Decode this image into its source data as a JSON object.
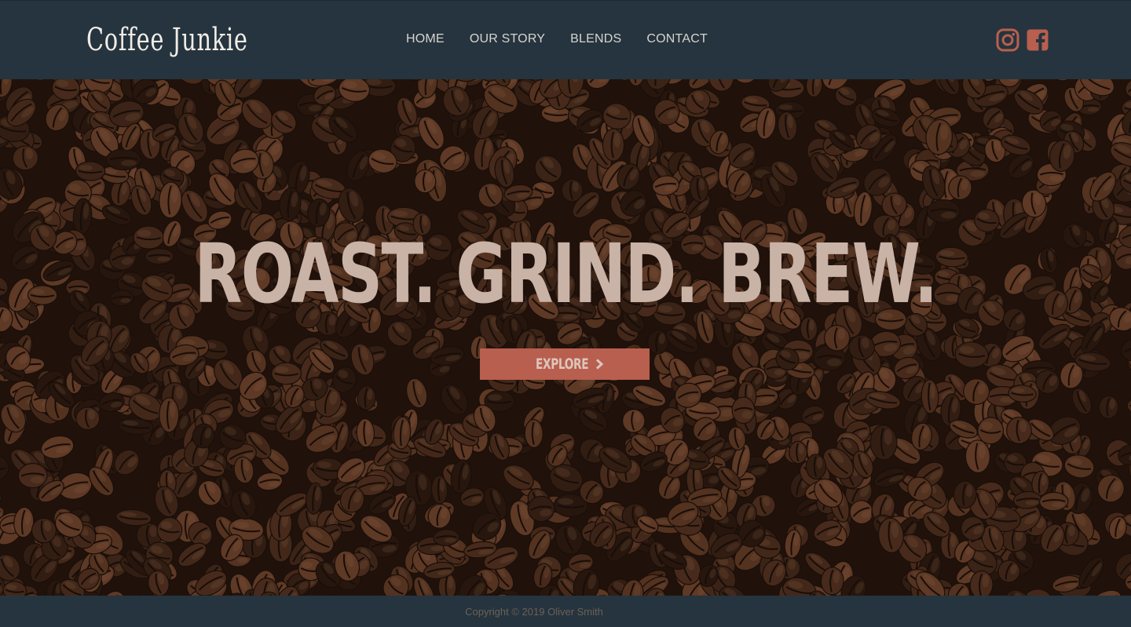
{
  "brand": {
    "name": "Coffee Junkie"
  },
  "nav": {
    "items": [
      {
        "label": "HOME"
      },
      {
        "label": "OUR STORY"
      },
      {
        "label": "BLENDS"
      },
      {
        "label": "CONTACT"
      }
    ]
  },
  "social": {
    "icons": [
      "instagram-icon",
      "facebook-icon"
    ],
    "color": "#b85f4f"
  },
  "hero": {
    "headline": "ROAST. GRIND. BREW.",
    "cta_label": "EXPLORE",
    "cta_icon": "chevron-right-icon",
    "cta_color": "#b85f4f"
  },
  "footer": {
    "copyright": "Copyright © 2019 Oliver Smith"
  },
  "colors": {
    "header_bg": "#25343e",
    "headline": "#c9b2a6",
    "nav_text": "#d9d4cf"
  }
}
